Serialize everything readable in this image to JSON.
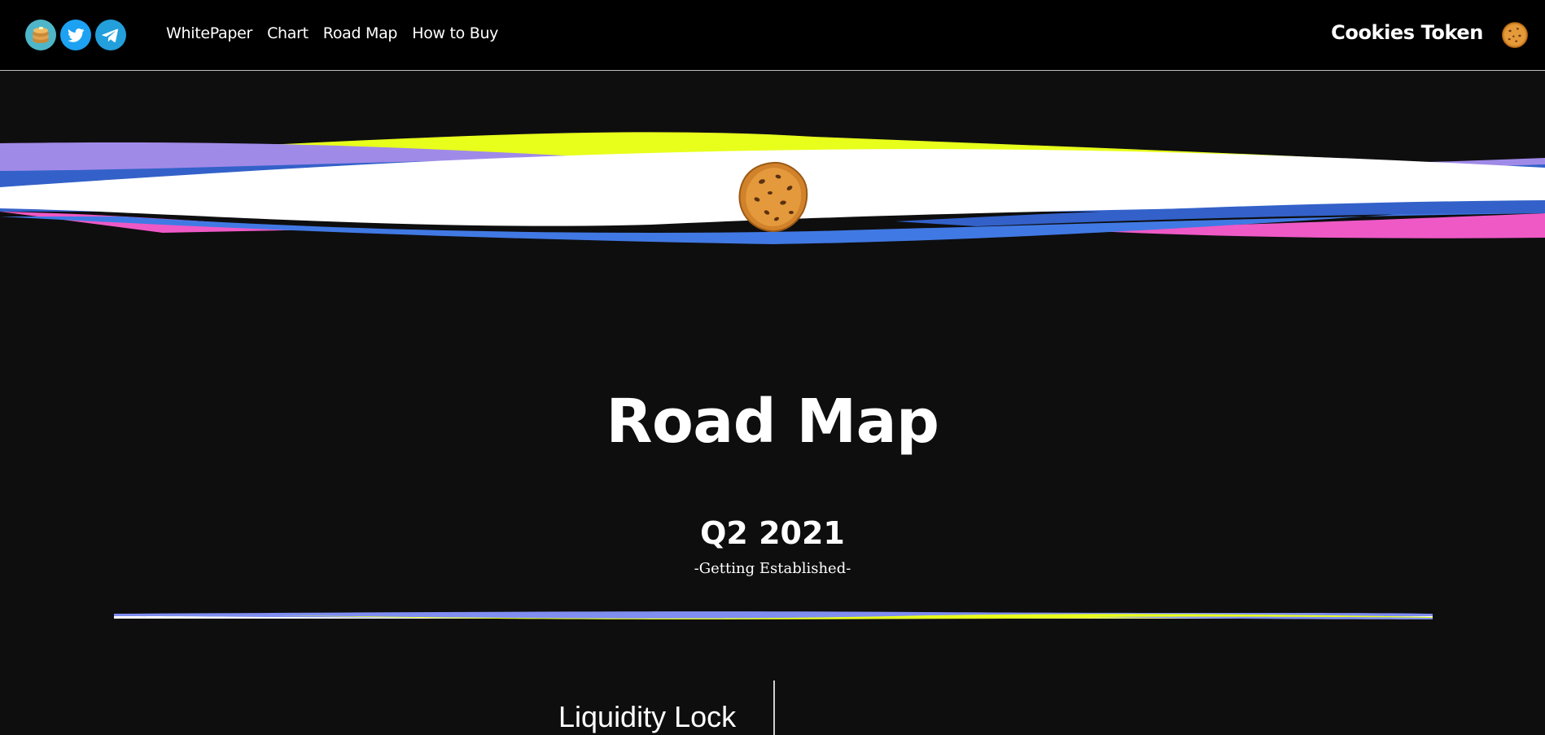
{
  "nav": {
    "social": [
      {
        "name": "pancakeswap",
        "icon": "pancake-icon",
        "color": "#4fb6c9"
      },
      {
        "name": "twitter",
        "icon": "twitter-icon",
        "color": "#1da1f2"
      },
      {
        "name": "telegram",
        "icon": "telegram-icon",
        "color": "#239fdb"
      }
    ],
    "links": [
      "WhitePaper",
      "Chart",
      "Road Map",
      "How to Buy"
    ],
    "brand": "Cookies Token",
    "brand_icon": "cookie-icon"
  },
  "hero": {
    "icon": "cookie-icon",
    "wave_colors": [
      "#a08ae8",
      "#e8ff1c",
      "#3361c9",
      "#ffffff",
      "#ee59c6",
      "#4179e4"
    ]
  },
  "roadmap": {
    "title": "Road Map",
    "quarter": "Q2 2021",
    "subtitle": "-Getting Established-",
    "first_item": "Liquidity Lock"
  }
}
